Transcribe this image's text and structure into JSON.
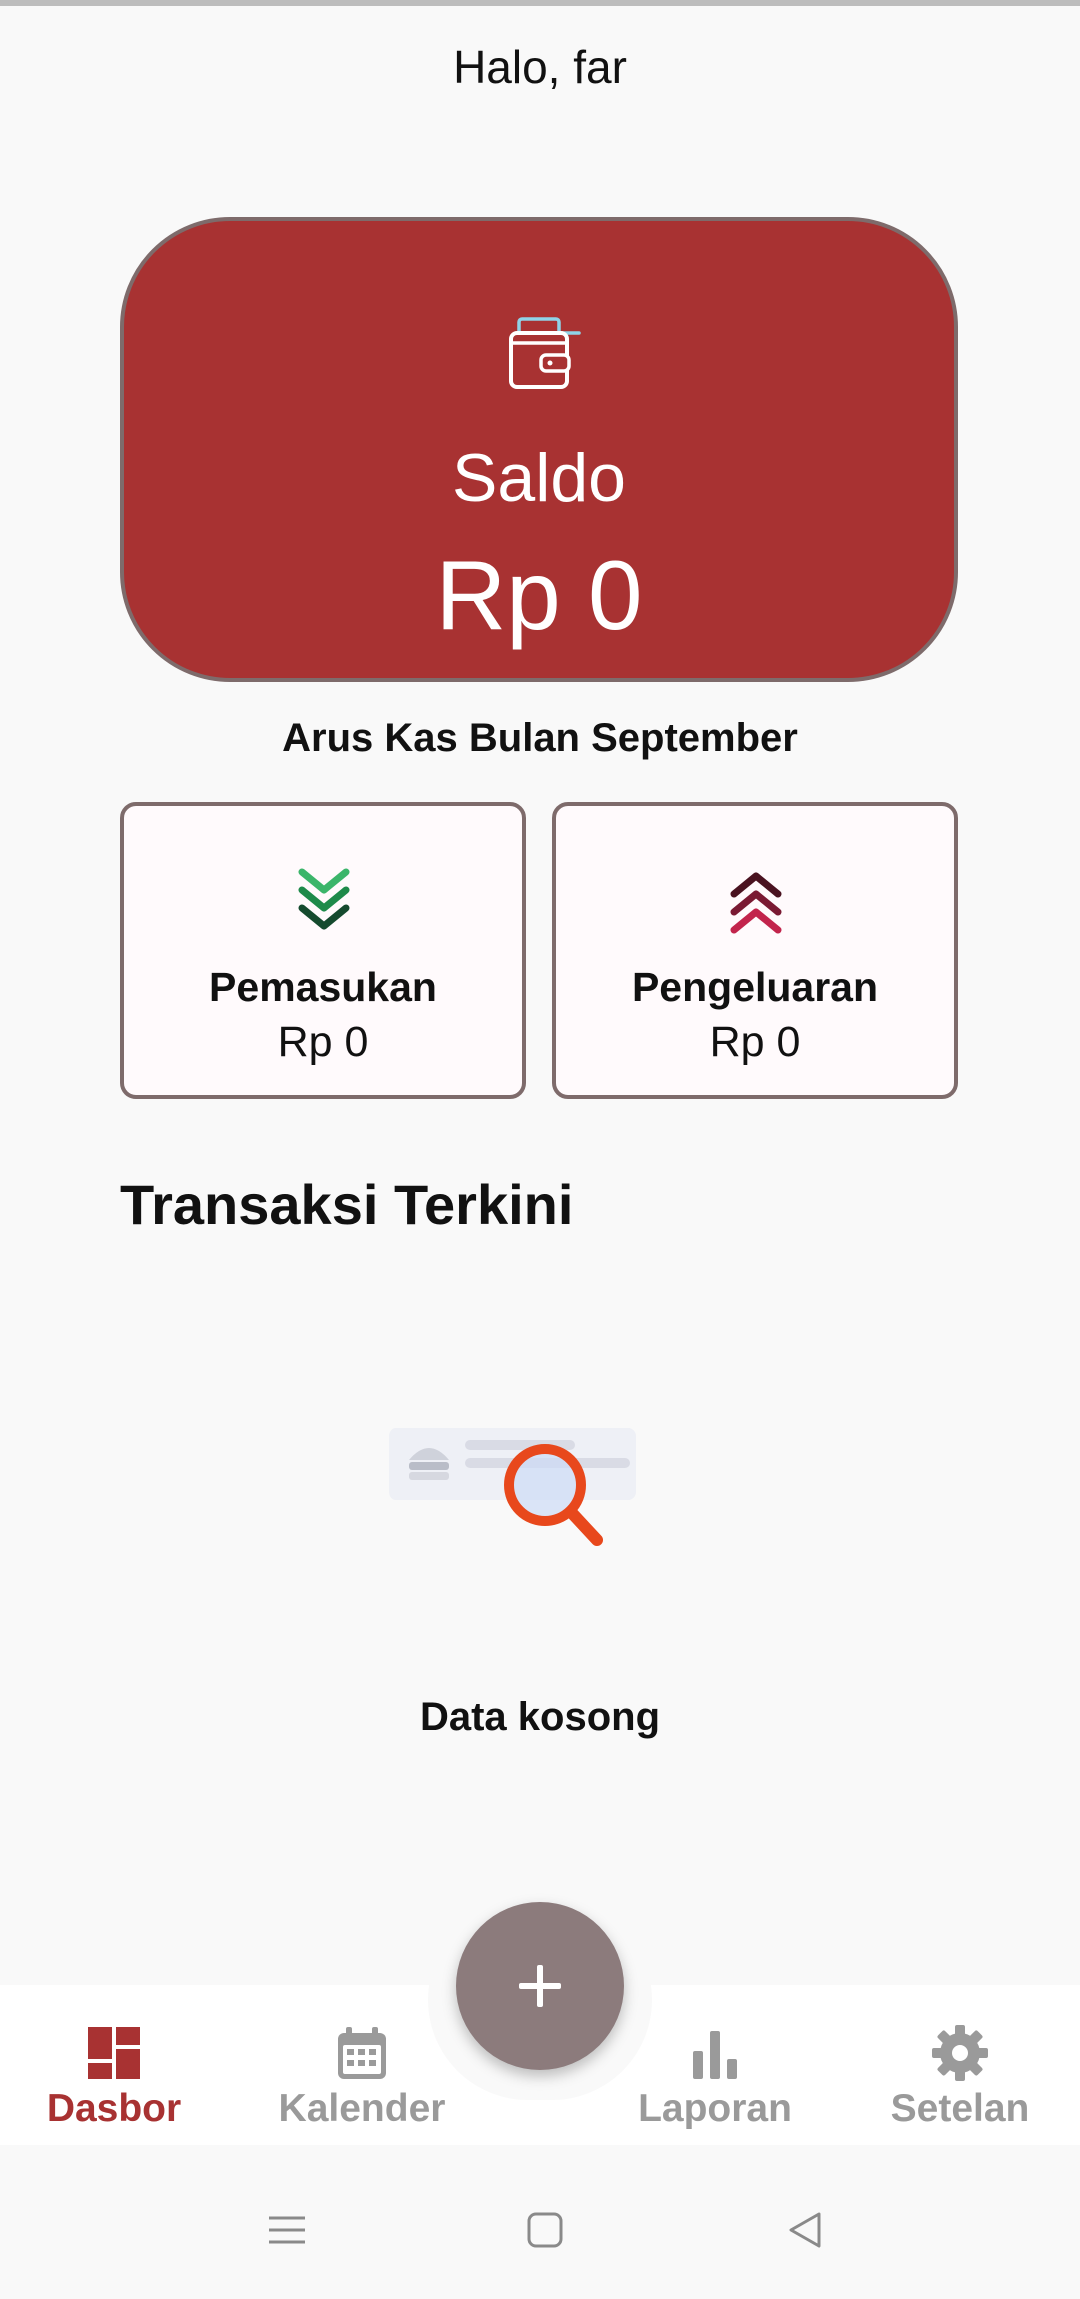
{
  "header": {
    "greeting": "Halo, far"
  },
  "balance": {
    "icon": "wallet-icon",
    "label": "Saldo",
    "value": "Rp 0",
    "color": "#a83232"
  },
  "cashflow": {
    "title": "Arus Kas Bulan September",
    "income": {
      "icon": "chevrons-down-icon",
      "label": "Pemasukan",
      "value": "Rp 0"
    },
    "expense": {
      "icon": "chevrons-up-icon",
      "label": "Pengeluaran",
      "value": "Rp 0"
    }
  },
  "transactions": {
    "title": "Transaksi Terkini",
    "empty_text": "Data kosong"
  },
  "fab": {
    "icon": "plus-icon"
  },
  "nav": {
    "items": [
      {
        "label": "Dasbor",
        "icon": "dashboard-icon",
        "active": true
      },
      {
        "label": "Kalender",
        "icon": "calendar-icon",
        "active": false
      },
      {
        "label": "Laporan",
        "icon": "bar-chart-icon",
        "active": false
      },
      {
        "label": "Setelan",
        "icon": "gear-icon",
        "active": false
      }
    ]
  },
  "system_nav": {
    "icons": [
      "menu-icon",
      "home-icon",
      "back-icon"
    ]
  },
  "colors": {
    "accent": "#a83232",
    "fab": "#8c7b7c",
    "card_border": "#7e6b6b",
    "income_icon": "#1e8a4a",
    "expense_icon": "#8e1d3a",
    "inactive_nav": "#9a9a9a"
  }
}
